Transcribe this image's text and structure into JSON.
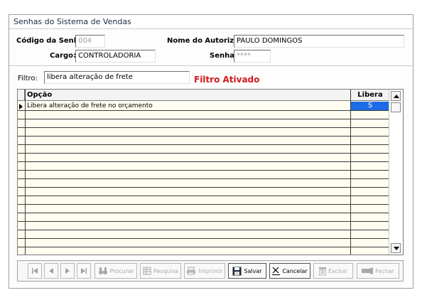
{
  "window": {
    "title": "Senhas do Sistema de Vendas"
  },
  "form": {
    "codigo_label": "Código da Senha:",
    "codigo_value": "004",
    "nome_label": "Nome do Autorizado:",
    "nome_value": "PAULO DOMINGOS",
    "cargo_label": "Cargo:",
    "cargo_value": "CONTROLADORIA",
    "senha_label": "Senha:",
    "senha_value": "****"
  },
  "filter": {
    "label": "Filtro:",
    "value": "libera alteração de frete",
    "status": "Filtro Ativado",
    "status_color": "#d11a1a"
  },
  "grid": {
    "columns": [
      "Opção",
      "Libera"
    ],
    "rows": [
      {
        "opcao": "Libera alteração de frete no orçamento",
        "libera": "S"
      }
    ],
    "selection_color": "#1c6be6"
  },
  "toolbar": {
    "procurar": "Procurar",
    "pesquisa": "Pesquisa",
    "imprimir": "Imprimir",
    "salvar": "Salvar",
    "cancelar": "Cancelar",
    "excluir": "Excluir",
    "fechar": "Fechar"
  }
}
